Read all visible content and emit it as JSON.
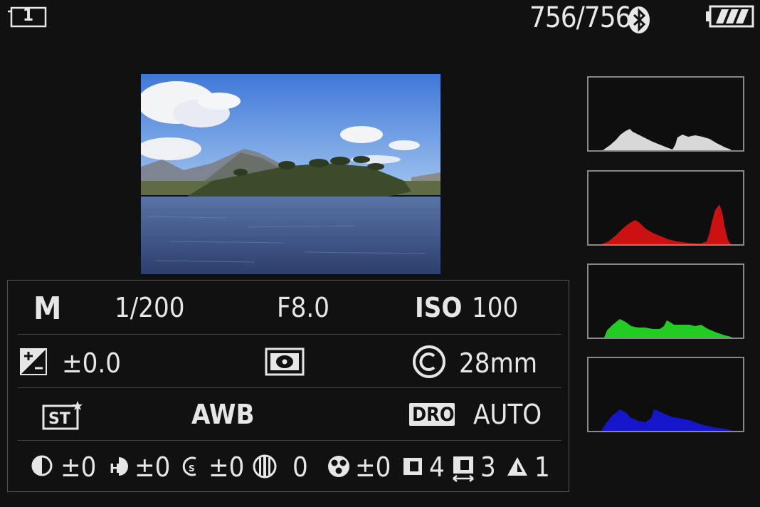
{
  "status_bar": {
    "memory_slot": "1",
    "shot_counter": "756/756",
    "bluetooth_icon": "bluetooth-icon",
    "battery_icon": "battery-full-icon"
  },
  "exposure": {
    "mode": "M",
    "shutter": "1/200",
    "aperture": "F8.0",
    "iso_label": "ISO",
    "iso_value": "100"
  },
  "row2": {
    "exposure_comp": "±0.0",
    "metering_icon": "multi-metering-icon",
    "focal_length": "28mm"
  },
  "row3": {
    "creative_style_icon": "creative-style-standard-icon",
    "white_balance": "AWB",
    "dro_label": "DRO",
    "dro_value": "AUTO"
  },
  "row4": {
    "contrast": "±0",
    "highlights": "±0",
    "shadows": "±0",
    "fade": "0",
    "saturation": "±0",
    "sharpness": "4",
    "sharpness_range": "3",
    "clarity": "1"
  },
  "histograms": [
    {
      "name": "luminance",
      "color": "#d8d8d8"
    },
    {
      "name": "red",
      "color": "#cc1111"
    },
    {
      "name": "green",
      "color": "#22cc22"
    },
    {
      "name": "blue",
      "color": "#1515cc"
    }
  ]
}
